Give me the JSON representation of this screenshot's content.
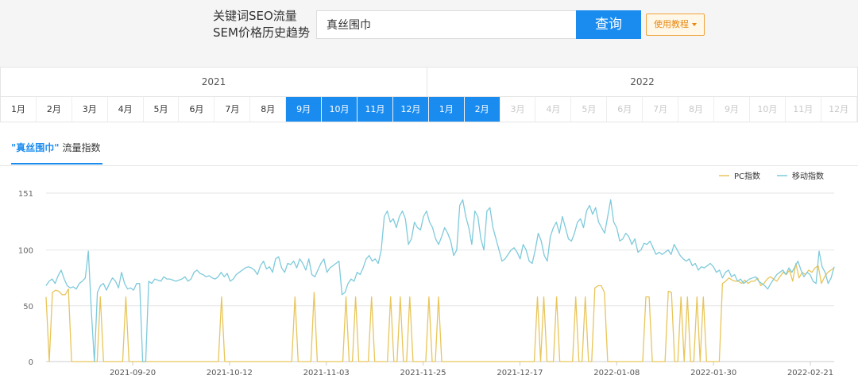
{
  "header": {
    "title_line1": "关键词SEO流量",
    "title_line2": "SEM价格历史趋势",
    "search_value": "真丝围巾",
    "search_button": "查询",
    "tutorial_button": "使用教程"
  },
  "years": [
    "2021",
    "2022"
  ],
  "months_2021": [
    {
      "label": "1月",
      "state": "normal"
    },
    {
      "label": "2月",
      "state": "normal"
    },
    {
      "label": "3月",
      "state": "normal"
    },
    {
      "label": "4月",
      "state": "normal"
    },
    {
      "label": "5月",
      "state": "normal"
    },
    {
      "label": "6月",
      "state": "normal"
    },
    {
      "label": "7月",
      "state": "normal"
    },
    {
      "label": "8月",
      "state": "normal"
    },
    {
      "label": "9月",
      "state": "active"
    },
    {
      "label": "10月",
      "state": "active"
    },
    {
      "label": "11月",
      "state": "active"
    },
    {
      "label": "12月",
      "state": "active"
    }
  ],
  "months_2022": [
    {
      "label": "1月",
      "state": "active"
    },
    {
      "label": "2月",
      "state": "active"
    },
    {
      "label": "3月",
      "state": "disabled"
    },
    {
      "label": "4月",
      "state": "disabled"
    },
    {
      "label": "5月",
      "state": "disabled"
    },
    {
      "label": "6月",
      "state": "disabled"
    },
    {
      "label": "7月",
      "state": "disabled"
    },
    {
      "label": "8月",
      "state": "disabled"
    },
    {
      "label": "9月",
      "state": "disabled"
    },
    {
      "label": "10月",
      "state": "disabled"
    },
    {
      "label": "11月",
      "state": "disabled"
    },
    {
      "label": "12月",
      "state": "disabled"
    }
  ],
  "tab": {
    "keyword": "\"真丝围巾\"",
    "label": "流量指数"
  },
  "colors": {
    "accent": "#1a8cf0",
    "pc": "#e8c55a",
    "mobile": "#7ecadb"
  },
  "chart_data": {
    "type": "line",
    "ylim": [
      0,
      151
    ],
    "yticks": [
      0,
      50,
      100,
      151
    ],
    "xtick_labels": [
      "2021-09-20",
      "2021-10-12",
      "2021-11-03",
      "2021-11-25",
      "2021-12-17",
      "2022-01-08",
      "2022-01-30",
      "2022-02-21"
    ],
    "legend_position": "top-right",
    "series": [
      {
        "name": "PC指数",
        "values": [
          58,
          0,
          62,
          64,
          63,
          60,
          60,
          65,
          0,
          0,
          0,
          0,
          0,
          0,
          0,
          0,
          0,
          58,
          0,
          0,
          0,
          0,
          0,
          0,
          0,
          58,
          0,
          0,
          0,
          0,
          0,
          0,
          0,
          0,
          0,
          0,
          0,
          0,
          0,
          0,
          0,
          0,
          0,
          0,
          0,
          0,
          0,
          0,
          0,
          0,
          0,
          0,
          0,
          0,
          0,
          58,
          0,
          0,
          0,
          0,
          0,
          0,
          0,
          0,
          0,
          0,
          0,
          0,
          0,
          0,
          0,
          0,
          0,
          0,
          0,
          0,
          0,
          0,
          58,
          0,
          0,
          0,
          0,
          0,
          62,
          0,
          0,
          0,
          0,
          0,
          0,
          0,
          0,
          0,
          58,
          0,
          0,
          58,
          0,
          0,
          0,
          0,
          58,
          0,
          0,
          0,
          0,
          0,
          58,
          0,
          0,
          58,
          0,
          0,
          58,
          0,
          0,
          0,
          0,
          0,
          58,
          0,
          0,
          58,
          0,
          0,
          0,
          0,
          0,
          0,
          0,
          0,
          0,
          0,
          0,
          0,
          0,
          0,
          0,
          0,
          0,
          0,
          0,
          0,
          0,
          0,
          0,
          0,
          0,
          0,
          0,
          0,
          0,
          0,
          58,
          0,
          58,
          0,
          0,
          0,
          58,
          0,
          0,
          0,
          0,
          0,
          58,
          0,
          0,
          58,
          0,
          0,
          66,
          68,
          68,
          62,
          0,
          0,
          0,
          0,
          0,
          0,
          0,
          0,
          0,
          0,
          0,
          0,
          58,
          58,
          0,
          0,
          0,
          0,
          0,
          63,
          62,
          0,
          0,
          58,
          0,
          58,
          0,
          0,
          58,
          0,
          58,
          0,
          0,
          0,
          0,
          0,
          70,
          72,
          75,
          73,
          72,
          72,
          70,
          73,
          70,
          72,
          72,
          75,
          68,
          70,
          74,
          76,
          74,
          72,
          76,
          80,
          78,
          82,
          72,
          88,
          75,
          80,
          78,
          82,
          80,
          84,
          86,
          70,
          76,
          80,
          82,
          84
        ]
      },
      {
        "name": "移动指数",
        "values": [
          68,
          72,
          74,
          70,
          77,
          82,
          74,
          68,
          66,
          67,
          65,
          70,
          72,
          75,
          99,
          45,
          0,
          62,
          68,
          70,
          64,
          70,
          75,
          72,
          66,
          80,
          70,
          65,
          66,
          64,
          70,
          70,
          0,
          0,
          72,
          70,
          74,
          73,
          72,
          76,
          74,
          74,
          73,
          72,
          73,
          74,
          76,
          72,
          74,
          80,
          82,
          79,
          78,
          76,
          77,
          75,
          74,
          76,
          80,
          76,
          79,
          72,
          74,
          78,
          80,
          82,
          84,
          85,
          84,
          82,
          78,
          86,
          90,
          83,
          85,
          80,
          92,
          94,
          84,
          80,
          88,
          87,
          90,
          84,
          92,
          88,
          82,
          92,
          78,
          76,
          82,
          88,
          92,
          80,
          84,
          86,
          88,
          90,
          60,
          62,
          70,
          74,
          72,
          80,
          78,
          84,
          92,
          95,
          90,
          92,
          88,
          100,
          130,
          135,
          125,
          128,
          120,
          130,
          135,
          128,
          105,
          110,
          125,
          120,
          118,
          130,
          135,
          125,
          120,
          110,
          105,
          112,
          120,
          115,
          108,
          95,
          100,
          140,
          145,
          130,
          120,
          105,
          135,
          130,
          110,
          100,
          135,
          138,
          120,
          110,
          100,
          90,
          92,
          96,
          100,
          102,
          98,
          92,
          105,
          100,
          90,
          88,
          100,
          115,
          108,
          95,
          90,
          112,
          120,
          125,
          115,
          130,
          120,
          110,
          108,
          115,
          125,
          128,
          120,
          135,
          140,
          132,
          138,
          125,
          120,
          115,
          130,
          145,
          125,
          120,
          108,
          110,
          115,
          112,
          105,
          110,
          98,
          100,
          106,
          105,
          108,
          102,
          96,
          98,
          96,
          98,
          100,
          96,
          105,
          100,
          95,
          92,
          90,
          92,
          86,
          88,
          82,
          85,
          84,
          86,
          88,
          85,
          80,
          82,
          75,
          80,
          82,
          76,
          78,
          72,
          74,
          70,
          72,
          74,
          75,
          76,
          72,
          70,
          68,
          65,
          70,
          74,
          78,
          80,
          82,
          78,
          84,
          80,
          85,
          90,
          82,
          76,
          80,
          78,
          72,
          70,
          99,
          85,
          80,
          70,
          75,
          85
        ]
      }
    ]
  }
}
